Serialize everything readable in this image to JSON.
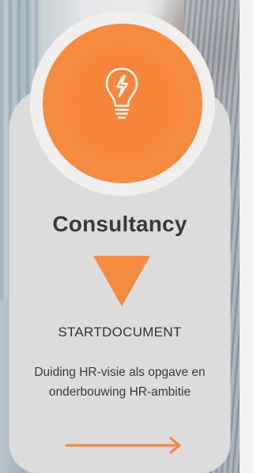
{
  "card": {
    "title": "Consultancy",
    "subtitle": "STARTDOCUMENT",
    "description": "Duiding HR-visie als opgave en onderbouwing HR-ambitie",
    "icon": "lightbulb-icon",
    "arrow_icon": "arrow-right-icon"
  },
  "colors": {
    "accent": "#f58b3f",
    "card_bg": "#dcdcdc",
    "text": "#3a3a3a"
  }
}
